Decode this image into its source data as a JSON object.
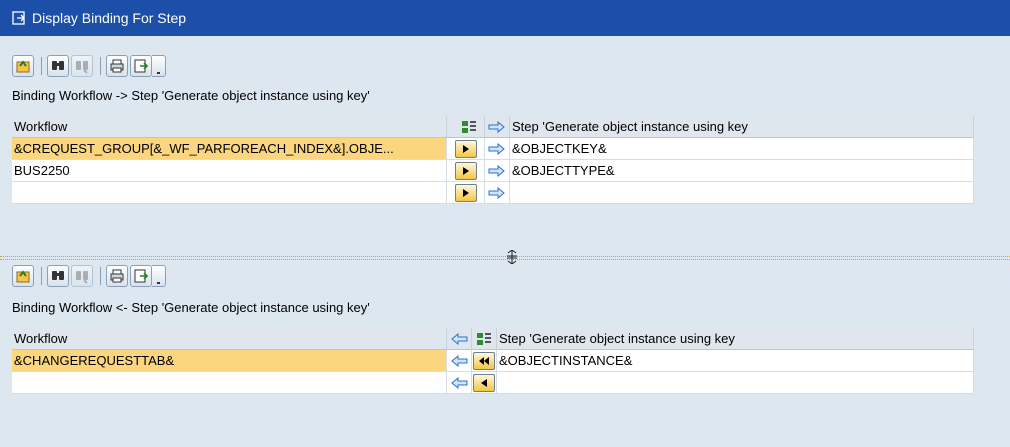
{
  "window": {
    "title": "Display Binding For Step"
  },
  "colors": {
    "title_bar": "#1b4fa8",
    "selected_row": "#fbd67e",
    "background": "#dde7f0"
  },
  "toolbar_icons": [
    "pick-icon",
    "find-icon",
    "find-next-icon",
    "print-icon",
    "export-icon",
    "dropdown-icon"
  ],
  "top": {
    "heading": "Binding Workflow  -> Step 'Generate object instance using key'",
    "col_left": "Workflow",
    "col_right": "Step 'Generate object instance using key",
    "rows": [
      {
        "left": "&CREQUEST_GROUP[&_WF_PARFOREACH_INDEX&].OBJE...",
        "right": "&OBJECTKEY&"
      },
      {
        "left": "BUS2250",
        "right": "&OBJECTTYPE&"
      },
      {
        "left": "",
        "right": ""
      }
    ]
  },
  "bottom": {
    "heading": "Binding Workflow  <- Step 'Generate object instance using key'",
    "col_left": "Workflow",
    "col_right": "Step 'Generate object instance using key",
    "rows": [
      {
        "left": "&CHANGEREQUESTTAB&",
        "right": "&OBJECTINSTANCE&"
      },
      {
        "left": "",
        "right": ""
      }
    ]
  }
}
